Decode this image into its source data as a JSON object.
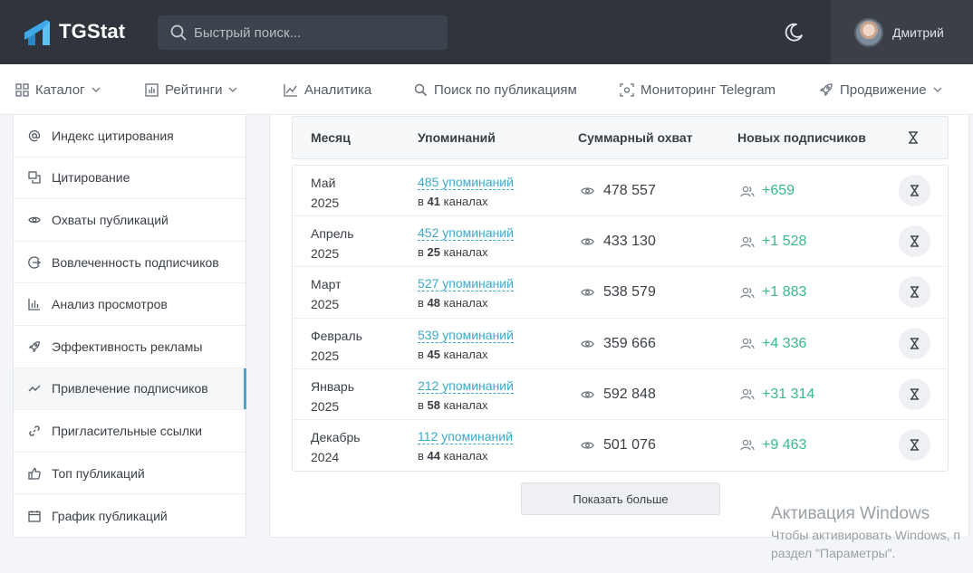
{
  "header": {
    "logo_text": "TGStat",
    "search_placeholder": "Быстрый поиск...",
    "user_name": "Дмитрий"
  },
  "nav": [
    {
      "label": "Каталог",
      "icon": "grid-icon",
      "dropdown": true
    },
    {
      "label": "Рейтинги",
      "icon": "bar-chart-icon",
      "dropdown": true
    },
    {
      "label": "Аналитика",
      "icon": "line-chart-icon",
      "dropdown": false
    },
    {
      "label": "Поиск по публикациям",
      "icon": "search-icon",
      "dropdown": false
    },
    {
      "label": "Мониторинг Telegram",
      "icon": "scan-icon",
      "dropdown": false
    },
    {
      "label": "Продвижение",
      "icon": "rocket-icon",
      "dropdown": true
    }
  ],
  "sidebar": {
    "items": [
      {
        "label": "Индекс цитирования",
        "icon": "at-icon"
      },
      {
        "label": "Цитирование",
        "icon": "quote-icon"
      },
      {
        "label": "Охваты публикаций",
        "icon": "eye-icon"
      },
      {
        "label": "Вовлеченность подписчиков",
        "icon": "engagement-icon"
      },
      {
        "label": "Анализ просмотров",
        "icon": "bar-chart-icon"
      },
      {
        "label": "Эффективность рекламы",
        "icon": "rocket-icon"
      },
      {
        "label": "Привлечение подписчиков",
        "icon": "trend-icon",
        "active": true
      },
      {
        "label": "Пригласительные ссылки",
        "icon": "link-icon"
      },
      {
        "label": "Топ публикаций",
        "icon": "thumb-up-icon"
      },
      {
        "label": "График публикаций",
        "icon": "calendar-icon"
      }
    ]
  },
  "table": {
    "headers": {
      "month": "Месяц",
      "mentions": "Упоминаний",
      "reach": "Суммарный охват",
      "subscribers": "Новых подписчиков"
    },
    "in_prefix": "в",
    "channels_suffix": "каналах",
    "rows": [
      {
        "month": "Май",
        "year": "2025",
        "mentions": "485 упоминаний",
        "channels": "41",
        "reach": "478 557",
        "subs": "+659"
      },
      {
        "month": "Апрель",
        "year": "2025",
        "mentions": "452 упоминаний",
        "channels": "25",
        "reach": "433 130",
        "subs": "+1 528"
      },
      {
        "month": "Март",
        "year": "2025",
        "mentions": "527 упоминаний",
        "channels": "48",
        "reach": "538 579",
        "subs": "+1 883"
      },
      {
        "month": "Февраль",
        "year": "2025",
        "mentions": "539 упоминаний",
        "channels": "45",
        "reach": "359 666",
        "subs": "+4 336"
      },
      {
        "month": "Январь",
        "year": "2025",
        "mentions": "212 упоминаний",
        "channels": "58",
        "reach": "592 848",
        "subs": "+31 314"
      },
      {
        "month": "Декабрь",
        "year": "2024",
        "mentions": "112 упоминаний",
        "channels": "44",
        "reach": "501 076",
        "subs": "+9 463"
      }
    ]
  },
  "show_more_label": "Показать больше",
  "watermark": {
    "title": "Активация Windows",
    "line1": "Чтобы активировать Windows, п",
    "line2": "раздел \"Параметры\"."
  },
  "colors": {
    "header_bg": "#2f343d",
    "link": "#3ba9c9",
    "positive": "#38b98a",
    "active_marker": "#49a6c9"
  }
}
